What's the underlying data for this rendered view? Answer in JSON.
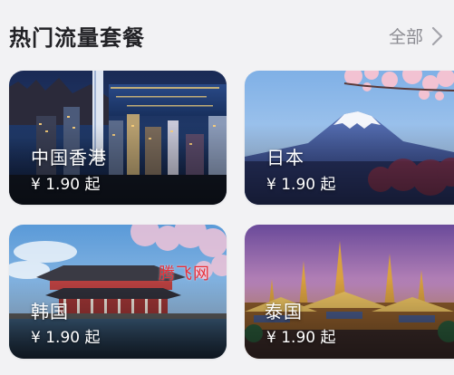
{
  "section": {
    "title": "热门流量套餐",
    "see_all_label": "全部"
  },
  "icons": {
    "see_all": "chevron-right-icon"
  },
  "packages": [
    {
      "name": "中国香港",
      "price": "¥ 1.90 起"
    },
    {
      "name": "日本",
      "price": "¥ 1.90 起"
    },
    {
      "name": "韩国",
      "price": "¥ 1.90 起"
    },
    {
      "name": "泰国",
      "price": "¥ 1.90 起"
    }
  ],
  "watermark": "腾飞网",
  "colors": {
    "page_background": "#f2f2f4",
    "title_text": "#222226",
    "secondary_text": "#8c8c92",
    "card_text": "#ffffff",
    "watermark": "#e8303a"
  }
}
